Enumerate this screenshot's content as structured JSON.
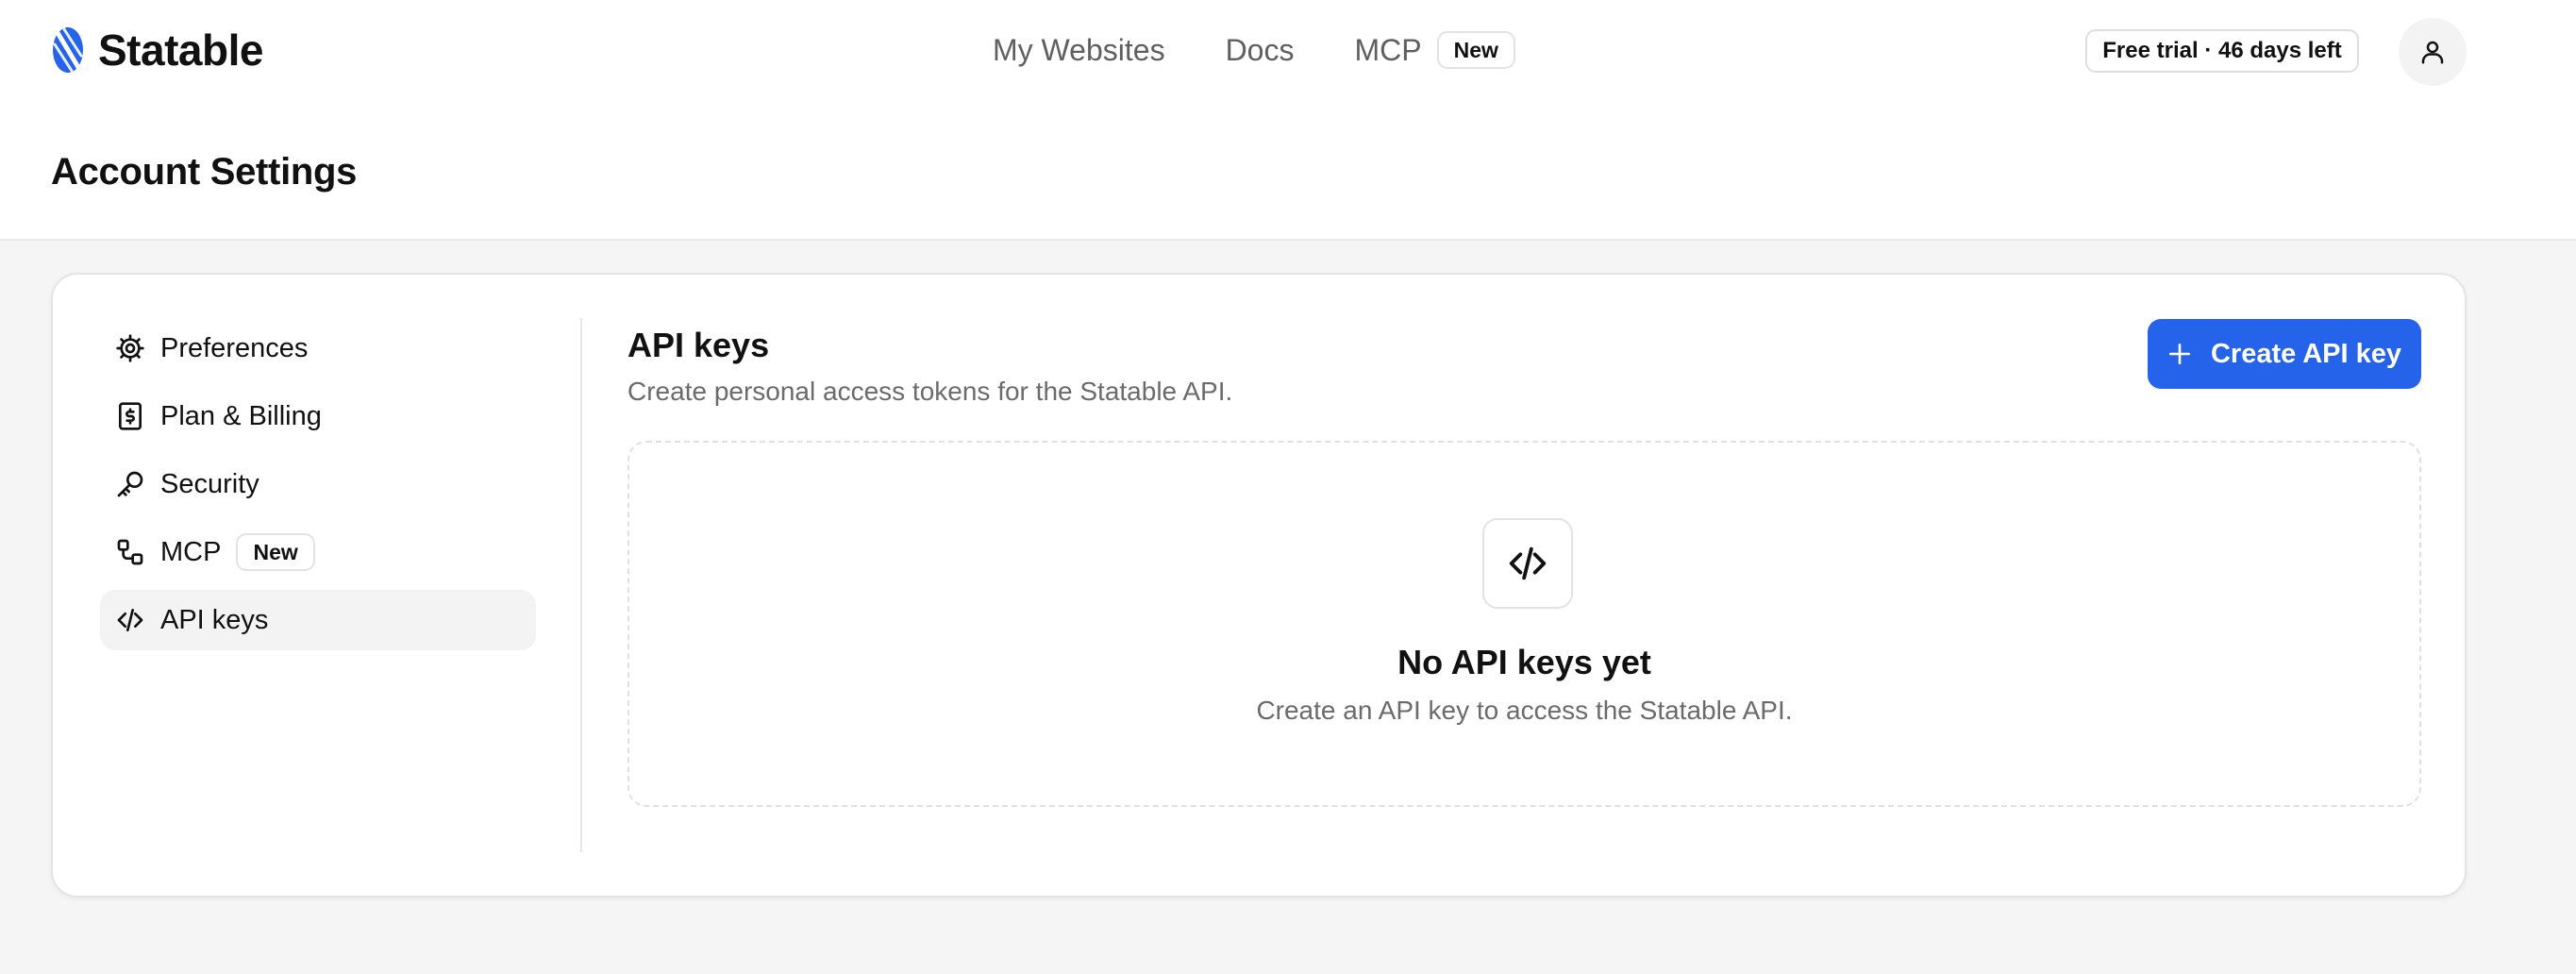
{
  "brand": {
    "name": "Statable",
    "accent_color": "#2563eb"
  },
  "nav": {
    "items": [
      {
        "label": "My Websites"
      },
      {
        "label": "Docs"
      },
      {
        "label": "MCP",
        "badge": "New"
      }
    ]
  },
  "header": {
    "trial_status": "Free trial · 46 days left",
    "avatar_icon": "user-icon"
  },
  "page": {
    "title": "Account Settings"
  },
  "sidebar": {
    "items": [
      {
        "label": "Preferences",
        "icon": "gear-icon",
        "active": false
      },
      {
        "label": "Plan & Billing",
        "icon": "billing-icon",
        "active": false
      },
      {
        "label": "Security",
        "icon": "key-icon",
        "active": false
      },
      {
        "label": "MCP",
        "icon": "mcp-icon",
        "badge": "New",
        "active": false
      },
      {
        "label": "API keys",
        "icon": "code-icon",
        "active": true
      }
    ]
  },
  "main": {
    "title": "API keys",
    "subtitle": "Create personal access tokens for the Statable API.",
    "create_button": {
      "label": "Create API key",
      "icon": "plus-icon"
    },
    "empty_state": {
      "icon": "code-icon",
      "title": "No API keys yet",
      "subtitle": "Create an API key to access the Statable API."
    }
  }
}
